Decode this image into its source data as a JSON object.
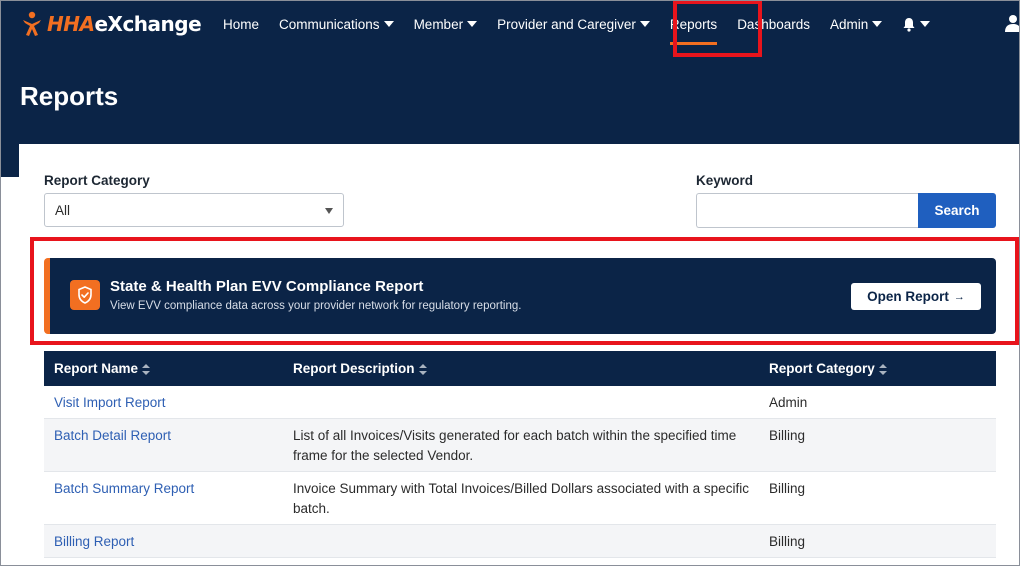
{
  "brand": {
    "logo_text_part1": "HHA",
    "logo_text_part2": "eXchange",
    "orange": "#f26f21",
    "navy": "#0b2447",
    "link_blue": "#2e5fb3",
    "highlight_red": "#e8141c"
  },
  "nav": {
    "items": [
      {
        "label": "Home",
        "dropdown": false
      },
      {
        "label": "Communications",
        "dropdown": true
      },
      {
        "label": "Member",
        "dropdown": true
      },
      {
        "label": "Provider and Caregiver",
        "dropdown": true
      },
      {
        "label": "Reports",
        "dropdown": false,
        "active": true
      },
      {
        "label": "Dashboards",
        "dropdown": false
      },
      {
        "label": "Admin",
        "dropdown": true
      }
    ],
    "icons": [
      "bell-icon",
      "user-icon"
    ]
  },
  "page": {
    "title": "Reports"
  },
  "filters": {
    "category_label": "Report Category",
    "category_value": "All",
    "keyword_label": "Keyword",
    "keyword_value": "",
    "keyword_placeholder": "",
    "search_label": "Search"
  },
  "banner": {
    "icon": "shield-check-icon",
    "title": "State & Health Plan EVV Compliance Report",
    "subtitle": "View EVV compliance data across your provider network for regulatory reporting.",
    "button_label": "Open Report",
    "button_arrow": "→"
  },
  "table": {
    "columns": [
      "Report Name",
      "Report Description",
      "Report Category"
    ],
    "rows": [
      {
        "name": "Visit Import Report",
        "description": "",
        "category": "Admin"
      },
      {
        "name": "Batch Detail Report",
        "description": "List of all Invoices/Visits generated for each batch within the specified time frame for the selected Vendor.",
        "category": "Billing"
      },
      {
        "name": "Batch Summary Report",
        "description": "Invoice Summary with Total Invoices/Billed Dollars associated with a specific batch.",
        "category": "Billing"
      },
      {
        "name": "Billing Report",
        "description": "",
        "category": "Billing"
      }
    ]
  }
}
